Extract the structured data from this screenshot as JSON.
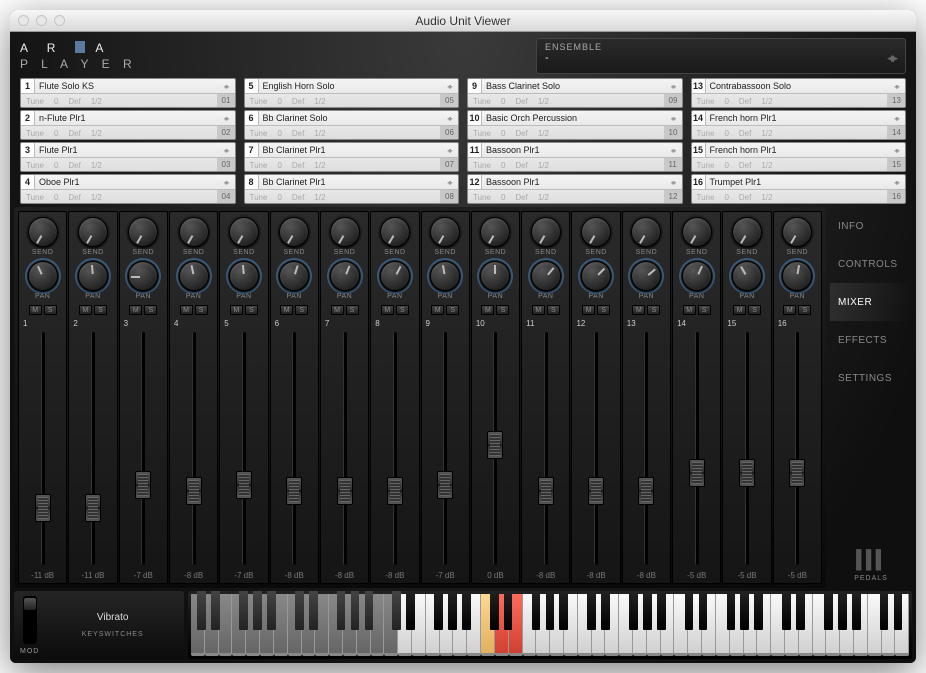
{
  "window": {
    "title": "Audio Unit Viewer"
  },
  "preset": {
    "label": "ENSEMBLE",
    "value": "-"
  },
  "slot_labels": {
    "tune": "Tune",
    "tune_val": "0",
    "def": "Def",
    "frac": "1/2"
  },
  "slots": [
    {
      "n": 1,
      "name": "Flute Solo KS",
      "ch": "01"
    },
    {
      "n": 5,
      "name": "English Horn Solo",
      "ch": "05"
    },
    {
      "n": 9,
      "name": "Bass Clarinet Solo",
      "ch": "09"
    },
    {
      "n": 13,
      "name": "Contrabassoon Solo",
      "ch": "13"
    },
    {
      "n": 2,
      "name": "n-Flute Plr1",
      "ch": "02"
    },
    {
      "n": 6,
      "name": "Bb Clarinet Solo",
      "ch": "06"
    },
    {
      "n": 10,
      "name": "Basic Orch Percussion",
      "ch": "10"
    },
    {
      "n": 14,
      "name": "French horn Plr1",
      "ch": "14"
    },
    {
      "n": 3,
      "name": "Flute Plr1",
      "ch": "03"
    },
    {
      "n": 7,
      "name": "Bb Clarinet Plr1",
      "ch": "07"
    },
    {
      "n": 11,
      "name": "Bassoon Plr1",
      "ch": "11"
    },
    {
      "n": 15,
      "name": "French horn Plr1",
      "ch": "15"
    },
    {
      "n": 4,
      "name": "Oboe Plr1",
      "ch": "04"
    },
    {
      "n": 8,
      "name": "Bb Clarinet Plr1",
      "ch": "08"
    },
    {
      "n": 12,
      "name": "Bassoon Plr1",
      "ch": "12"
    },
    {
      "n": 16,
      "name": "Trumpet Plr1",
      "ch": "16"
    }
  ],
  "knob_labels": {
    "send": "SEND",
    "pan": "PAN"
  },
  "ms_labels": {
    "m": "M",
    "s": "S"
  },
  "channels": [
    {
      "ch": 1,
      "db": "-11 dB",
      "fader": 0.18,
      "pan": -25
    },
    {
      "ch": 2,
      "db": "-11 dB",
      "fader": 0.18,
      "pan": -5
    },
    {
      "ch": 3,
      "db": "-7 dB",
      "fader": 0.3,
      "pan": -90
    },
    {
      "ch": 4,
      "db": "-8 dB",
      "fader": 0.27,
      "pan": -12
    },
    {
      "ch": 5,
      "db": "-7 dB",
      "fader": 0.3,
      "pan": -5
    },
    {
      "ch": 6,
      "db": "-8 dB",
      "fader": 0.27,
      "pan": 18
    },
    {
      "ch": 7,
      "db": "-8 dB",
      "fader": 0.27,
      "pan": 22
    },
    {
      "ch": 8,
      "db": "-8 dB",
      "fader": 0.27,
      "pan": 28
    },
    {
      "ch": 9,
      "db": "-7 dB",
      "fader": 0.3,
      "pan": -10
    },
    {
      "ch": 10,
      "db": "0 dB",
      "fader": 0.5,
      "pan": 0
    },
    {
      "ch": 11,
      "db": "-8 dB",
      "fader": 0.27,
      "pan": 40
    },
    {
      "ch": 12,
      "db": "-8 dB",
      "fader": 0.27,
      "pan": 45
    },
    {
      "ch": 13,
      "db": "-8 dB",
      "fader": 0.27,
      "pan": 50
    },
    {
      "ch": 14,
      "db": "-5 dB",
      "fader": 0.36,
      "pan": 25
    },
    {
      "ch": 15,
      "db": "-5 dB",
      "fader": 0.36,
      "pan": -30
    },
    {
      "ch": 16,
      "db": "-5 dB",
      "fader": 0.36,
      "pan": 10
    }
  ],
  "tabs": [
    {
      "label": "INFO",
      "active": false
    },
    {
      "label": "CONTROLS",
      "active": false
    },
    {
      "label": "MIXER",
      "active": true
    },
    {
      "label": "EFFECTS",
      "active": false
    },
    {
      "label": "SETTINGS",
      "active": false
    }
  ],
  "pedals_label": "PEDALS",
  "mod": {
    "label": "MOD",
    "mode": "Vibrato",
    "keyswitches": "KEYSWITCHES"
  },
  "keyboard": {
    "white_total": 52,
    "dim_until": 15,
    "highlight": [
      {
        "idx": 21,
        "cls": "yel"
      },
      {
        "idx": 22,
        "cls": "red"
      },
      {
        "idx": 23,
        "cls": "red"
      }
    ]
  }
}
